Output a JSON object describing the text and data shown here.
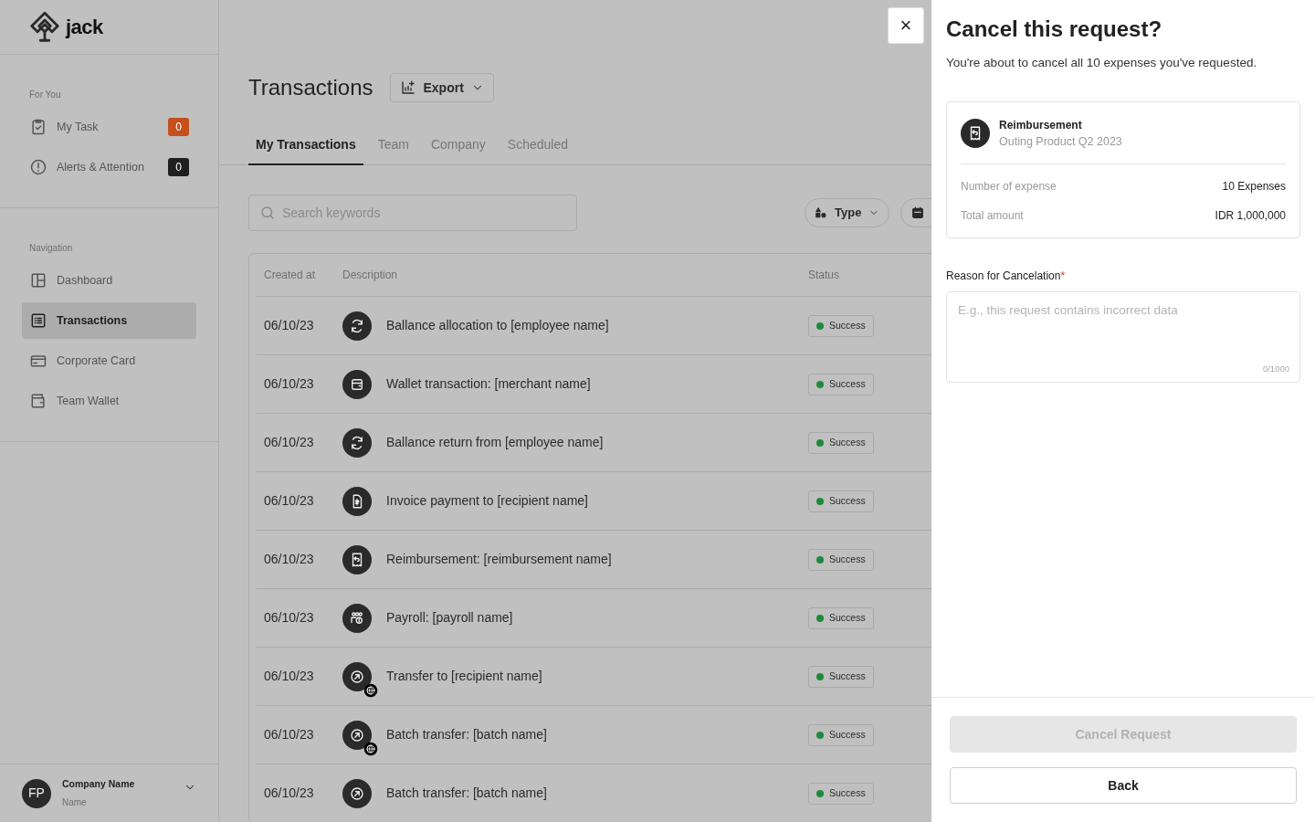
{
  "sidebar": {
    "logo": "jack",
    "sections": [
      {
        "title": "For You",
        "items": [
          {
            "label": "My Task",
            "selected": false,
            "count": "0",
            "color": "#c4501c"
          },
          {
            "label": "Alerts & Attention",
            "selected": false,
            "count": "0",
            "color": "#1f1f1f"
          }
        ]
      },
      {
        "title": "Navigation",
        "items": [
          {
            "label": "Dashboard",
            "selected": false
          },
          {
            "label": "Transactions",
            "selected": true
          },
          {
            "label": "Corporate Card",
            "selected": false
          },
          {
            "label": "Team Wallet",
            "selected": false
          }
        ]
      }
    ],
    "account": {
      "initials": "FP",
      "company": "Company Name",
      "name": "Name"
    }
  },
  "page": {
    "title": "Transactions",
    "export_button": "Export",
    "tabs": [
      {
        "label": "My Transactions",
        "selected": true
      },
      {
        "label": "Team",
        "selected": false
      },
      {
        "label": "Company",
        "selected": false
      },
      {
        "label": "Scheduled",
        "selected": false
      }
    ],
    "search": {
      "placeholder": "Search keywords"
    },
    "filters": [
      {
        "label": "Type"
      }
    ],
    "table": {
      "columns": [
        "Created at",
        "Description",
        "Status"
      ],
      "rows": [
        {
          "date": "06/10/23",
          "kind": "allocation",
          "international": false,
          "description": "Ballance allocation to [employee name]",
          "status": "Success"
        },
        {
          "date": "06/10/23",
          "kind": "wallet",
          "international": false,
          "description": "Wallet transaction: [merchant name]",
          "status": "Success"
        },
        {
          "date": "06/10/23",
          "kind": "allocation",
          "international": false,
          "description": "Ballance return from [employee name]",
          "status": "Success"
        },
        {
          "date": "06/10/23",
          "kind": "invoice",
          "international": false,
          "description": "Invoice payment to [recipient name]",
          "status": "Success"
        },
        {
          "date": "06/10/23",
          "kind": "reimbursement",
          "international": false,
          "description": "Reimbursement: [reimbursement name]",
          "status": "Success"
        },
        {
          "date": "06/10/23",
          "kind": "payroll",
          "international": false,
          "description": "Payroll: [payroll name]",
          "status": "Success"
        },
        {
          "date": "06/10/23",
          "kind": "transfer",
          "international": true,
          "description": "Transfer to [recipient name]",
          "status": "Success"
        },
        {
          "date": "06/10/23",
          "kind": "transfer",
          "international": true,
          "description": "Batch transfer: [batch name]",
          "status": "Success"
        },
        {
          "date": "06/10/23",
          "kind": "transfer",
          "international": false,
          "description": "Batch transfer: [batch name]",
          "status": "Success"
        }
      ]
    }
  },
  "dialog": {
    "close": "×",
    "title": "Cancel this request?",
    "subtitle": "You're about to cancel all 10 expenses you've requested.",
    "summary": {
      "title": "Reimbursement",
      "subtitle": "Outing Product Q2 2023",
      "rows": [
        {
          "label": "Number of expense",
          "value": "10 Expenses"
        },
        {
          "label": "Total amount",
          "value": "IDR 1,000,000"
        }
      ]
    },
    "reason": {
      "label": "Reason for Cancelation",
      "required_mark": "*",
      "placeholder": "E.g., this request contains incorrect data",
      "counter": "0/1000"
    },
    "buttons": [
      {
        "label": "Cancel Request",
        "disabled": true
      },
      {
        "label": "Back",
        "disabled": false
      }
    ]
  }
}
